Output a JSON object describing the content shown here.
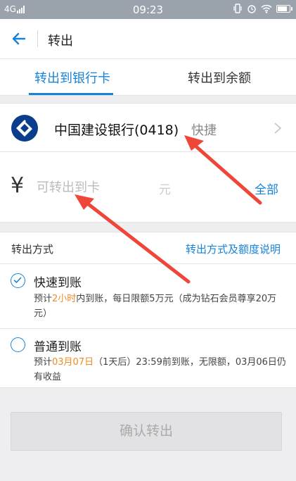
{
  "status_bar": {
    "network": "4G",
    "time": "09:23"
  },
  "nav": {
    "title": "转出"
  },
  "tabs": [
    {
      "label": "转出到银行卡",
      "active": true
    },
    {
      "label": "转出到余额",
      "active": false
    }
  ],
  "bank": {
    "name": "中国建设银行(0418)",
    "tag": "快捷",
    "logo_color": "#0a3d8c"
  },
  "amount": {
    "currency_symbol": "¥",
    "placeholder": "可转出到卡",
    "placeholder_suffix": "元",
    "all_label": "全部"
  },
  "transfer_method": {
    "title": "转出方式",
    "help_link": "转出方式及额度说明",
    "options": [
      {
        "label": "快速到账",
        "selected": true,
        "desc_pre": "预计",
        "desc_highlight": "2小时",
        "desc_post": "内到账，每日限额5万元（成为钻石会员尊享20万元）"
      },
      {
        "label": "普通到账",
        "selected": false,
        "desc_pre": "预计",
        "desc_highlight": "03月07日",
        "desc_post": "（1天后）23:59前到账，无限额，03月06日仍有收益"
      }
    ]
  },
  "confirm_button": {
    "label": "确认转出"
  },
  "colors": {
    "accent": "#1783d8",
    "highlight": "#f08a24",
    "annotation_arrow": "#f0463a"
  }
}
